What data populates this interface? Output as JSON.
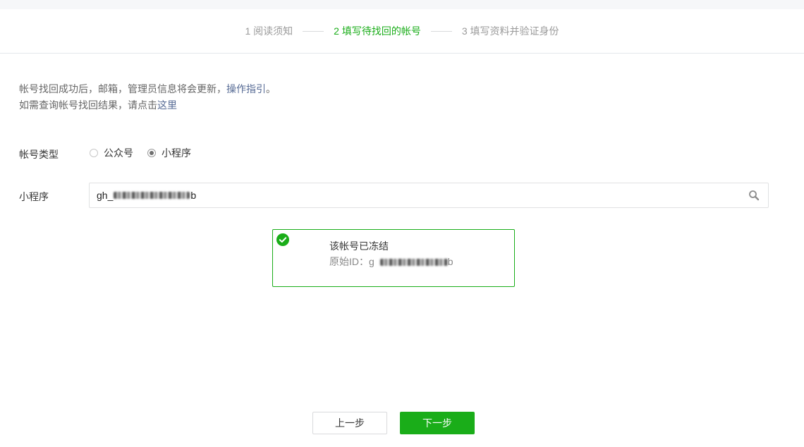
{
  "steps": [
    {
      "label": "1 阅读须知",
      "active": false
    },
    {
      "label": "2 填写待找回的帐号",
      "active": true
    },
    {
      "label": "3 填写资料并验证身份",
      "active": false
    }
  ],
  "notice": {
    "line1_text": "帐号找回成功后，邮箱，管理员信息将会更新，",
    "line1_link": "操作指引",
    "line1_end": "。",
    "line2_text": "如需查询帐号找回结果，请点击",
    "line2_link": "这里"
  },
  "account_type": {
    "label": "帐号类型",
    "options": [
      {
        "label": "公众号",
        "checked": false
      },
      {
        "label": "小程序",
        "checked": true
      }
    ]
  },
  "miniprogram": {
    "label": "小程序",
    "input_value_prefix": "gh_",
    "input_value_tail": "b",
    "search_icon": "search-icon"
  },
  "result": {
    "title": "该帐号已冻结",
    "id_label": "原始ID：",
    "id_prefix": "g",
    "id_tail": "b",
    "status_icon": "check-circle-icon"
  },
  "buttons": {
    "prev": "上一步",
    "next": "下一步"
  },
  "colors": {
    "accent": "#1aad19",
    "link": "#576b95"
  }
}
